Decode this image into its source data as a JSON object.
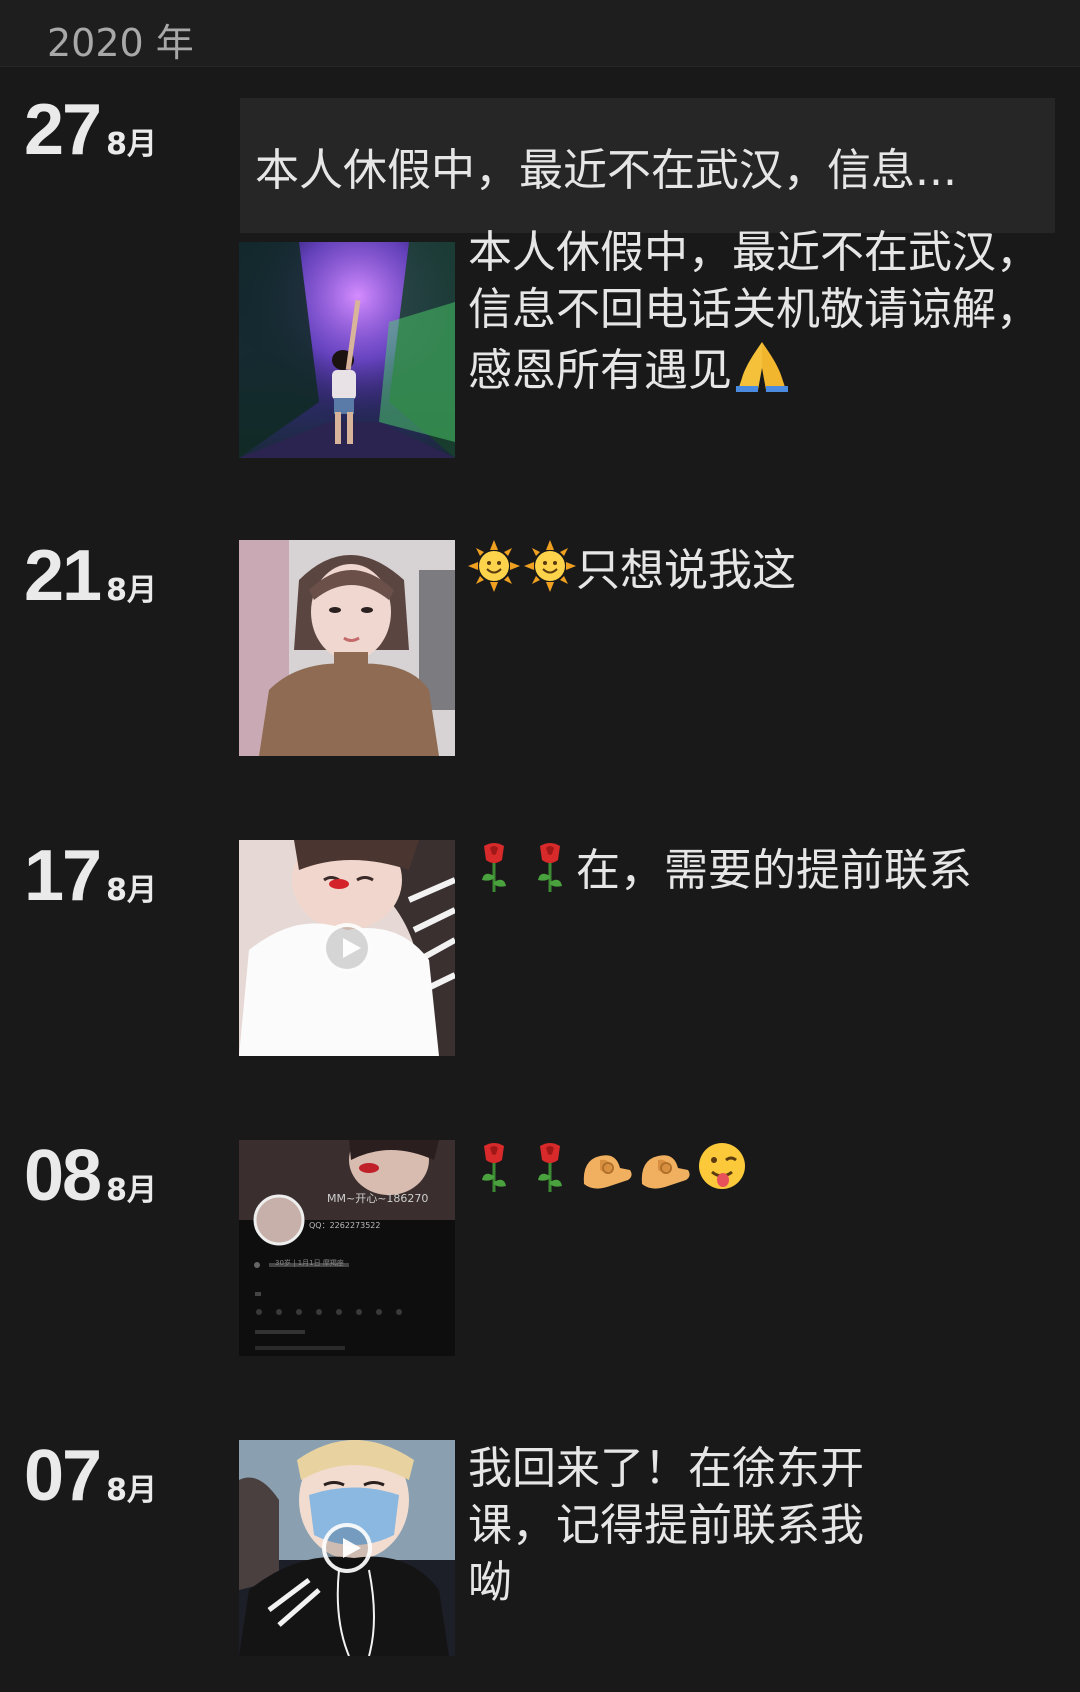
{
  "year_label": "2020 年",
  "entries": [
    {
      "day": "27",
      "month": "8月",
      "link_text": "本人休假中，最近不在武汉，信息...",
      "caption": "本人休假中，最近不在武汉，信息不回电话关机敬请谅解，感恩所有遇见",
      "emojis_after": [
        "pray-emoji"
      ]
    },
    {
      "day": "21",
      "month": "8月",
      "emojis_before": [
        "sun-emoji",
        "sun-emoji"
      ],
      "caption": "只想说我这"
    },
    {
      "day": "17",
      "month": "8月",
      "emojis_before": [
        "rose-emoji",
        "rose-emoji"
      ],
      "caption": "在，需要的提前联系",
      "video": true
    },
    {
      "day": "08",
      "month": "8月",
      "emojis_before": [
        "rose-emoji",
        "rose-emoji",
        "flex-arm-emoji",
        "flex-arm-emoji",
        "wink-tongue-emoji"
      ],
      "caption": "",
      "thumb_text": {
        "name": "MM~开心~186270",
        "qq": "QQ：2262273522",
        "info": "30岁 | 1月1日 摩羯座"
      }
    },
    {
      "day": "07",
      "month": "8月",
      "caption": "我回来了！在徐东开课，记得提前联系我呦",
      "video": true
    }
  ]
}
